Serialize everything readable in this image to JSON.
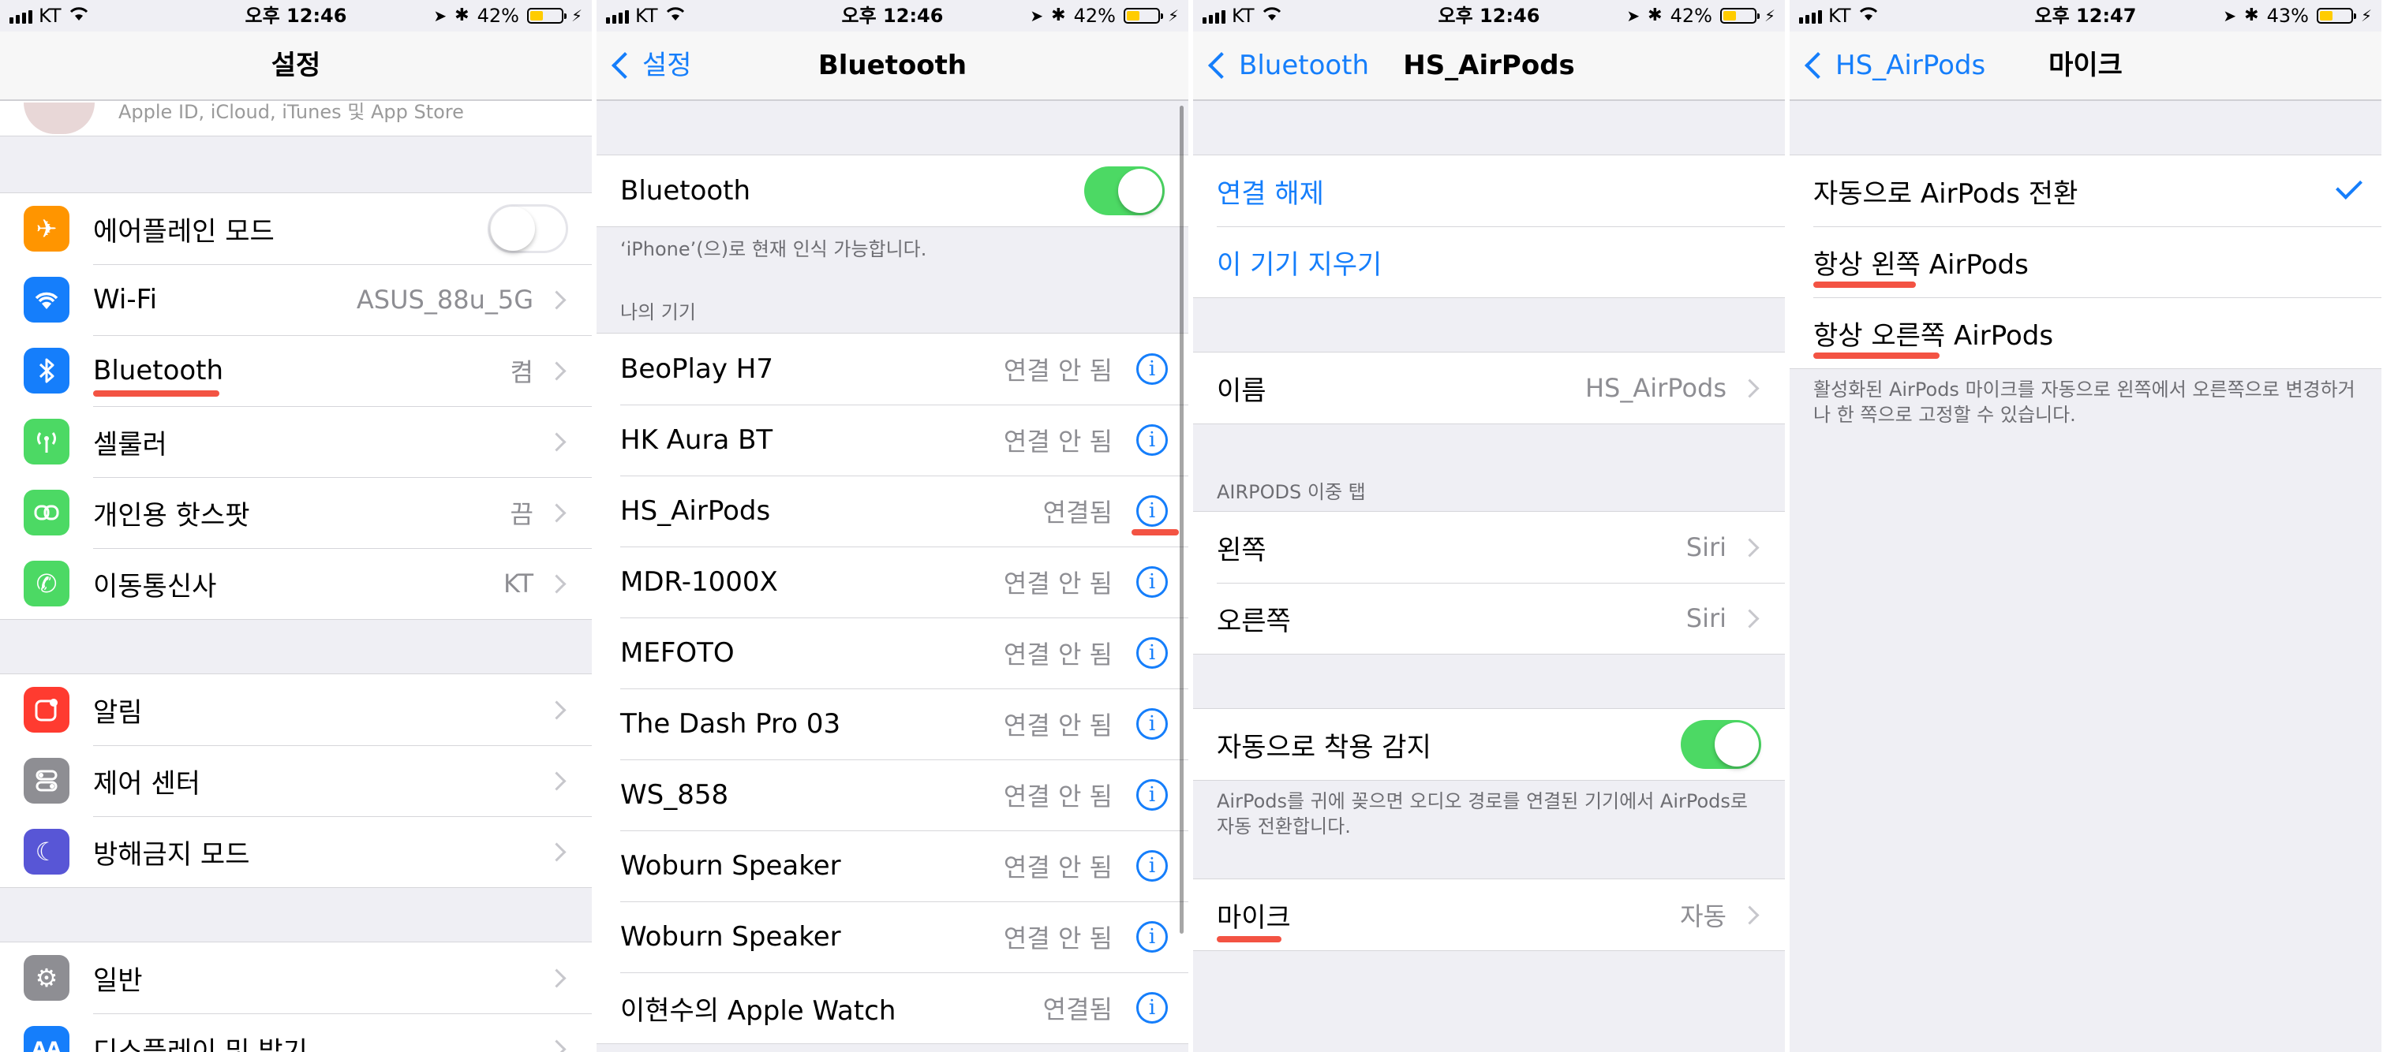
{
  "screen1": {
    "status": {
      "carrier": "KT",
      "time": "오후 12:46",
      "battery": "42%",
      "battery_level": 0.42
    },
    "title": "설정",
    "account_subtitle": "Apple ID, iCloud, iTunes 및 App Store",
    "group1": [
      {
        "label": "에어플레인 모드",
        "icon": "airplane-icon",
        "color": "#ff9500",
        "toggle": "off"
      },
      {
        "label": "Wi-Fi",
        "icon": "wifi-icon",
        "color": "#157efb",
        "value": "ASUS_88u_5G"
      },
      {
        "label": "Bluetooth",
        "icon": "bluetooth-icon",
        "color": "#157efb",
        "value": "켬"
      },
      {
        "label": "셀룰러",
        "icon": "cellular-icon",
        "color": "#4cd964"
      },
      {
        "label": "개인용 핫스팟",
        "icon": "hotspot-icon",
        "color": "#4cd964",
        "value": "끔"
      },
      {
        "label": "이동통신사",
        "icon": "phone-icon",
        "color": "#4cd964",
        "value": "KT"
      }
    ],
    "group2": [
      {
        "label": "알림",
        "icon": "notification-icon",
        "color": "#ff3b30"
      },
      {
        "label": "제어 센터",
        "icon": "control-center-icon",
        "color": "#8e8e93"
      },
      {
        "label": "방해금지 모드",
        "icon": "moon-icon",
        "color": "#5856d6"
      }
    ],
    "group3": [
      {
        "label": "일반",
        "icon": "gear-icon",
        "color": "#8e8e93"
      },
      {
        "label": "디스플레이 및 밝기",
        "icon": "display-icon",
        "color": "#157efb"
      }
    ]
  },
  "screen2": {
    "status": {
      "carrier": "KT",
      "time": "오후 12:46",
      "battery": "42%",
      "battery_level": 0.42
    },
    "back": "설정",
    "title": "Bluetooth",
    "bluetooth_label": "Bluetooth",
    "discoverable_note": "‘iPhone’(으)로 현재 인식 가능합니다.",
    "my_devices_header": "나의 기기",
    "devices": [
      {
        "name": "BeoPlay H7",
        "status": "연결 안 됨"
      },
      {
        "name": "HK Aura  BT",
        "status": "연결 안 됨"
      },
      {
        "name": "HS_AirPods",
        "status": "연결됨"
      },
      {
        "name": "MDR-1000X",
        "status": "연결 안 됨"
      },
      {
        "name": "MEFOTO",
        "status": "연결 안 됨"
      },
      {
        "name": "The Dash Pro 03",
        "status": "연결 안 됨"
      },
      {
        "name": "WS_858",
        "status": "연결 안 됨"
      },
      {
        "name": "Woburn Speaker",
        "status": "연결 안 됨"
      },
      {
        "name": "Woburn Speaker",
        "status": "연결 안 됨"
      },
      {
        "name": "이현수의 Apple Watch",
        "status": "연결됨"
      }
    ]
  },
  "screen3": {
    "status": {
      "carrier": "KT",
      "time": "오후 12:46",
      "battery": "42%",
      "battery_level": 0.42
    },
    "back": "Bluetooth",
    "title": "HS_AirPods",
    "disconnect": "연결 해제",
    "forget": "이 기기 지우기",
    "name_label": "이름",
    "name_value": "HS_AirPods",
    "double_tap_header": "AIRPODS 이중 탭",
    "left_label": "왼쪽",
    "left_value": "Siri",
    "right_label": "오른쪽",
    "right_value": "Siri",
    "ear_detection_label": "자동으로 착용 감지",
    "ear_detection_note": "AirPods를 귀에 꽂으면 오디오 경로를 연결된 기기에서 AirPods로 자동 전환합니다.",
    "mic_label": "마이크",
    "mic_value": "자동"
  },
  "screen4": {
    "status": {
      "carrier": "KT",
      "time": "오후 12:47",
      "battery": "43%",
      "battery_level": 0.43
    },
    "back": "HS_AirPods",
    "title": "마이크",
    "options": [
      {
        "label": "자동으로 AirPods 전환",
        "selected": true
      },
      {
        "label": "항상 왼쪽 AirPods",
        "selected": false
      },
      {
        "label": "항상 오른쪽 AirPods",
        "selected": false
      }
    ],
    "note": "활성화된 AirPods 마이크를 자동으로 왼쪽에서 오른쪽으로 변경하거나 한 쪽으로 고정할 수 있습니다."
  }
}
